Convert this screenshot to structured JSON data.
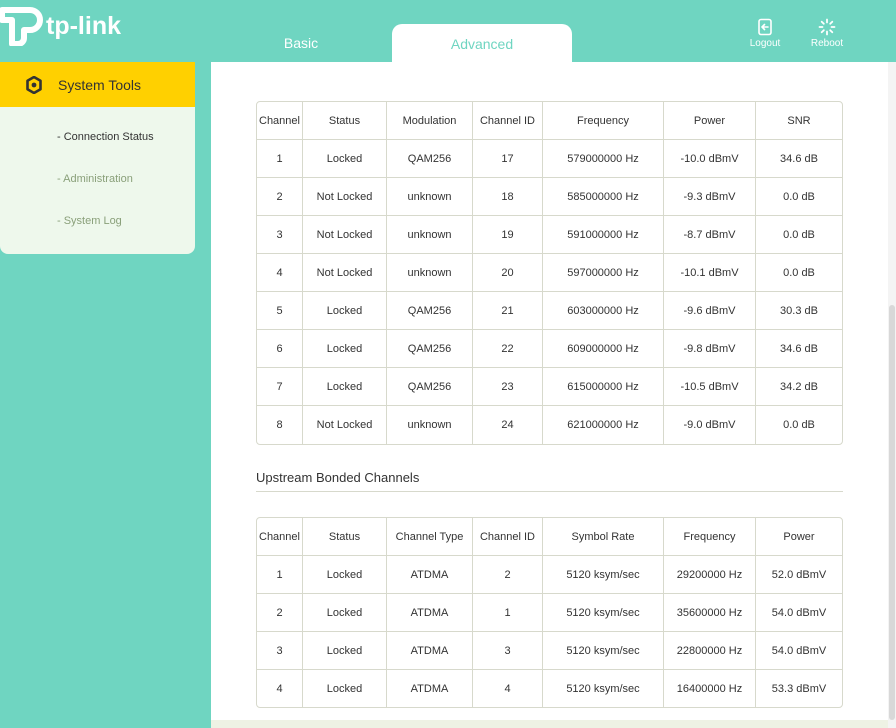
{
  "header": {
    "brand": "tp-link",
    "tabs": [
      {
        "label": "Basic"
      },
      {
        "label": "Advanced"
      }
    ],
    "logout_label": "Logout",
    "reboot_label": "Reboot",
    "logout_icon": "logout-icon",
    "reboot_icon": "reboot-icon"
  },
  "sidebar": {
    "active": {
      "label": "System Tools",
      "icon": "gear-icon"
    },
    "items": [
      {
        "label": "- Connection Status"
      },
      {
        "label": "- Administration"
      },
      {
        "label": "- System Log"
      }
    ]
  },
  "downstream": {
    "headers": [
      "Channel",
      "Status",
      "Modulation",
      "Channel ID",
      "Frequency",
      "Power",
      "SNR"
    ],
    "rows": [
      [
        "1",
        "Locked",
        "QAM256",
        "17",
        "579000000 Hz",
        "-10.0 dBmV",
        "34.6 dB"
      ],
      [
        "2",
        "Not Locked",
        "unknown",
        "18",
        "585000000 Hz",
        "-9.3 dBmV",
        "0.0 dB"
      ],
      [
        "3",
        "Not Locked",
        "unknown",
        "19",
        "591000000 Hz",
        "-8.7 dBmV",
        "0.0 dB"
      ],
      [
        "4",
        "Not Locked",
        "unknown",
        "20",
        "597000000 Hz",
        "-10.1 dBmV",
        "0.0 dB"
      ],
      [
        "5",
        "Locked",
        "QAM256",
        "21",
        "603000000 Hz",
        "-9.6 dBmV",
        "30.3 dB"
      ],
      [
        "6",
        "Locked",
        "QAM256",
        "22",
        "609000000 Hz",
        "-9.8 dBmV",
        "34.6 dB"
      ],
      [
        "7",
        "Locked",
        "QAM256",
        "23",
        "615000000 Hz",
        "-10.5 dBmV",
        "34.2 dB"
      ],
      [
        "8",
        "Not Locked",
        "unknown",
        "24",
        "621000000 Hz",
        "-9.0 dBmV",
        "0.0 dB"
      ]
    ]
  },
  "upstream": {
    "title": "Upstream Bonded Channels",
    "headers": [
      "Channel",
      "Status",
      "Channel Type",
      "Channel ID",
      "Symbol Rate",
      "Frequency",
      "Power"
    ],
    "rows": [
      [
        "1",
        "Locked",
        "ATDMA",
        "2",
        "5120 ksym/sec",
        "29200000 Hz",
        "52.0 dBmV"
      ],
      [
        "2",
        "Locked",
        "ATDMA",
        "1",
        "5120 ksym/sec",
        "35600000 Hz",
        "54.0 dBmV"
      ],
      [
        "3",
        "Locked",
        "ATDMA",
        "3",
        "5120 ksym/sec",
        "22800000 Hz",
        "54.0 dBmV"
      ],
      [
        "4",
        "Locked",
        "ATDMA",
        "4",
        "5120 ksym/sec",
        "16400000 Hz",
        "53.3 dBmV"
      ]
    ]
  },
  "colors": {
    "brand": "#6fd5c1",
    "active_nav": "#ffd000",
    "sidebar_panel": "#eef8ec"
  }
}
